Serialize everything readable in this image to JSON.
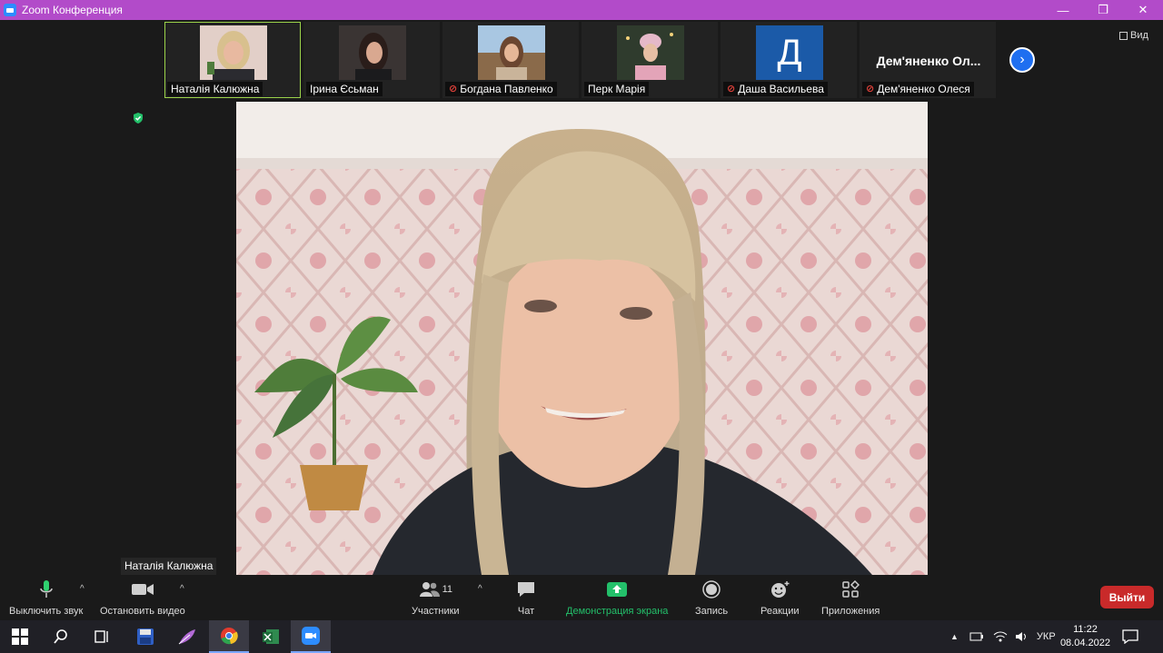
{
  "window": {
    "title": "Zoom Конференция",
    "minimize": "—",
    "maximize": "❐",
    "close": "✕"
  },
  "thumbnails": [
    {
      "name": "Наталія Калюжна",
      "muted": false,
      "kind": "video"
    },
    {
      "name": "Ірина Єсьман",
      "muted": false,
      "kind": "video"
    },
    {
      "name": "Богдана Павленко",
      "muted": true,
      "kind": "video"
    },
    {
      "name": "Перк Марія",
      "muted": false,
      "kind": "video"
    },
    {
      "name": "Даша Васильева",
      "muted": true,
      "kind": "letter",
      "letter": "Д"
    },
    {
      "name": "Дем'яненко Олеся",
      "muted": true,
      "kind": "text",
      "display": "Дем'яненко  Ол..."
    }
  ],
  "view_button": "Вид",
  "speaker_name": "Наталія Калюжна",
  "controls": {
    "mute": "Выключить звук",
    "video": "Остановить видео",
    "participants": "Участники",
    "participants_count": "11",
    "chat": "Чат",
    "share": "Демонстрация экрана",
    "record": "Запись",
    "reactions": "Реакции",
    "apps": "Приложения",
    "leave": "Выйти"
  },
  "taskbar": {
    "language": "УКР",
    "time": "11:22",
    "date": "08.04.2022"
  },
  "colors": {
    "title_bar": "#b24bc9",
    "active_speaker_border": "#9bd34a",
    "share_green": "#23c06a",
    "leave_red": "#c92a2a"
  }
}
